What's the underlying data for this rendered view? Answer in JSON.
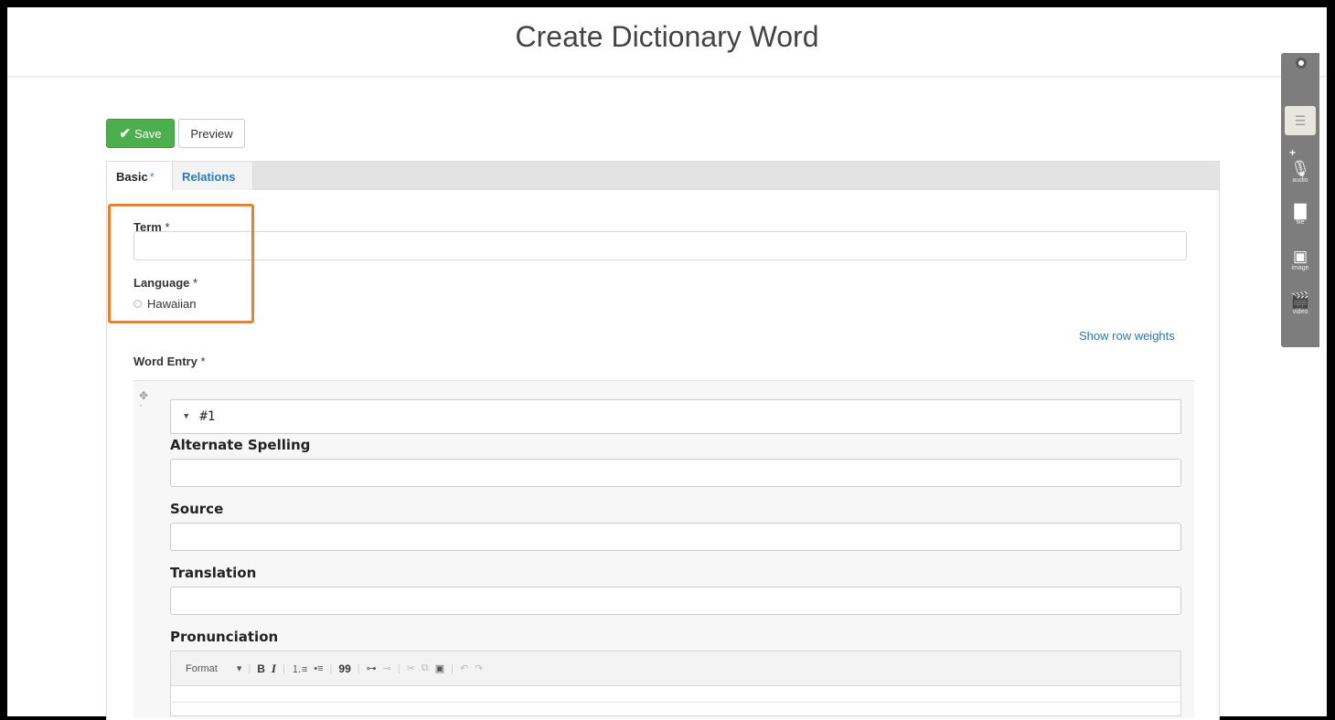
{
  "page": {
    "title": "Create Dictionary Word"
  },
  "actions": {
    "save_label": "Save",
    "preview_label": "Preview"
  },
  "tabs": [
    {
      "label": "Basic",
      "required": "*"
    },
    {
      "label": "Relations"
    }
  ],
  "form": {
    "term_label": "Term",
    "term_value": "",
    "language_label": "Language",
    "language_option": "Hawaiian",
    "required_mark": "*",
    "show_row_weights": "Show row weights",
    "word_entry_label": "Word Entry"
  },
  "entry": {
    "number": "#1",
    "alternate_spelling_label": "Alternate Spelling",
    "source_label": "Source",
    "translation_label": "Translation",
    "pronunciation_label": "Pronunciation"
  },
  "toolbar": {
    "format_label": "Format",
    "bold": "B",
    "italic": "I",
    "ordered_list": "⒈≡",
    "bulleted_list": "•≡",
    "blockquote": "99",
    "link": "⊶",
    "unlink": "⊸",
    "cut": "✂",
    "copy": "⧉",
    "paste": "▣",
    "undo": "↶",
    "redo": "↷"
  },
  "media_sidebar": {
    "items": [
      {
        "label": "audio",
        "icon": "microphone-icon"
      },
      {
        "label": "file",
        "icon": "file-icon"
      },
      {
        "label": "image",
        "icon": "image-icon"
      },
      {
        "label": "video",
        "icon": "clapperboard-icon"
      }
    ]
  },
  "colors": {
    "save_green": "#4cae4c",
    "link_blue": "#2a7ab8",
    "highlight_orange": "#e8822a",
    "sidebar_gray": "#7d7d7d"
  }
}
